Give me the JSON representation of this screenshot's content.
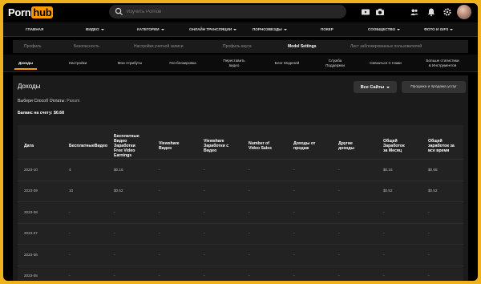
{
  "header": {
    "logo_part1": "Porn",
    "logo_part2": "hub",
    "search_placeholder": "Изучить Pornов",
    "icons": [
      "search-icon",
      "video-upload-icon",
      "camera-icon",
      "users-icon",
      "bell-icon",
      "gear-icon",
      "avatar"
    ]
  },
  "main_nav": [
    {
      "label": "ГЛАВНАЯ",
      "caret": false
    },
    {
      "label": "ВИДЕО",
      "caret": true
    },
    {
      "label": "КАТЕГОРИИ",
      "caret": true
    },
    {
      "label": "ОНЛАЙН ТРАНСЛЯЦИИ",
      "caret": true
    },
    {
      "label": "ПОРНОЗВЕЗДЫ",
      "caret": true
    },
    {
      "label": "ПОКЕР",
      "caret": false
    },
    {
      "label": "СООБЩЕСТВО",
      "caret": true
    },
    {
      "label": "ФОТО И GIFS",
      "caret": true
    }
  ],
  "settings_tabs": [
    "Профиль",
    "Безопасность",
    "Настройки учетной записи",
    "Профиль вкуса",
    "Model Settings",
    "Лист заблокированных пользователей"
  ],
  "settings_tabs_active": 4,
  "sub_nav": [
    [
      "Доходы"
    ],
    [
      "Настройки"
    ],
    [
      "Мои Атрибуты"
    ],
    [
      "Гео-блокировка"
    ],
    [
      "Переставить",
      "видео"
    ],
    [
      "Блог Моделей"
    ],
    [
      "Служба",
      "Поддержки"
    ],
    [
      "Связаться С Нами"
    ],
    [
      "Больше статистики",
      "& Инструментов"
    ]
  ],
  "sub_nav_active": 0,
  "earnings": {
    "title": "Доходы",
    "sites_button": "Все Сайты",
    "sales_button": "Продажа и продажа услуг",
    "payout_label": "Выбери Способ Оплаты:",
    "payout_value": "Paxum",
    "balance_label": "Баланс на счету:",
    "balance_value": "$0.68"
  },
  "table": {
    "headers": [
      [
        "Дата"
      ],
      [
        "БесплатныеВидео"
      ],
      [
        "Бесплатные",
        "Видео",
        "Заработки",
        "Free Video",
        "Earnings"
      ],
      [
        "Viewshare",
        "Видео"
      ],
      [
        "Viewshare",
        "Заработки с",
        "Видео"
      ],
      [
        "Number of",
        "Video Sales"
      ],
      [
        "Доходы от",
        "продаж"
      ],
      [
        "Другие",
        "доходы"
      ],
      [
        "Общей",
        "Заработок",
        "за Месяц"
      ],
      [
        "Общей",
        "заработок за",
        "все время"
      ]
    ],
    "rows": [
      [
        "2023-10",
        "4",
        "$0.16",
        "-",
        "-",
        "-",
        "-",
        "-",
        "$0.16",
        "$0.68"
      ],
      [
        "2023-09",
        "10",
        "$0.52",
        "-",
        "-",
        "-",
        "-",
        "-",
        "$0.52",
        "$0.52"
      ],
      [
        "2023-08",
        "-",
        "-",
        "-",
        "-",
        "-",
        "-",
        "-",
        "-",
        "-"
      ],
      [
        "2023-07",
        "-",
        "-",
        "-",
        "-",
        "-",
        "-",
        "-",
        "-",
        "-"
      ],
      [
        "2023-06",
        "-",
        "-",
        "-",
        "-",
        "-",
        "-",
        "-",
        "-",
        "-"
      ],
      [
        "2023-05",
        "-",
        "-",
        "-",
        "-",
        "-",
        "-",
        "-",
        "-",
        "-"
      ]
    ]
  }
}
